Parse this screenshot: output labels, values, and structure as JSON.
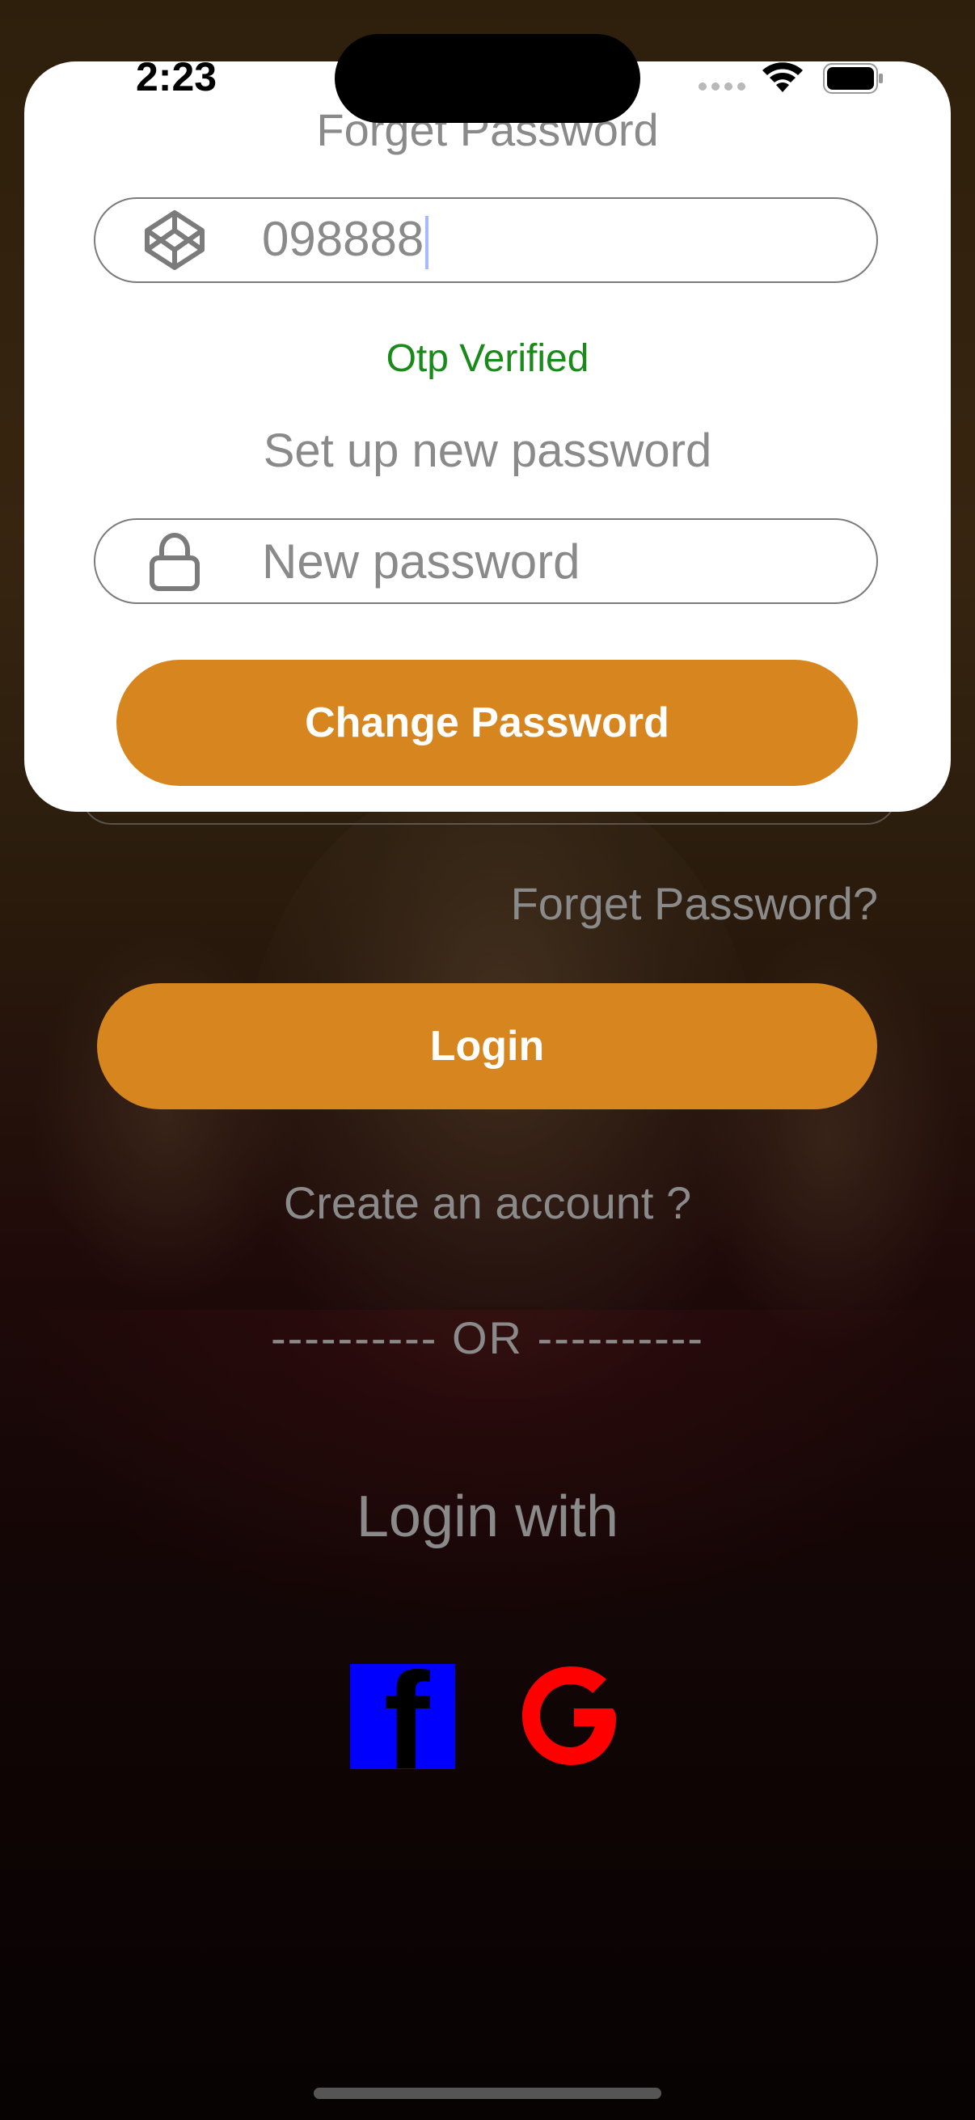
{
  "status_bar": {
    "time": "2:23"
  },
  "modal": {
    "title": "Forget Password",
    "otp_field": {
      "value": "098888",
      "icon": "codepen-cube-icon"
    },
    "otp_status": "Otp Verified",
    "setup_label": "Set up new password",
    "password_field": {
      "placeholder": "New password",
      "icon": "lock-icon"
    },
    "change_button": "Change Password"
  },
  "login": {
    "forget_link": "Forget Password?",
    "login_button": "Login",
    "create_account": "Create an account ?",
    "divider": "---------- OR ----------",
    "login_with": "Login with",
    "social": [
      {
        "name": "facebook",
        "icon": "facebook-icon",
        "color": "#0000ff"
      },
      {
        "name": "google",
        "icon": "google-icon",
        "color": "#ff0000"
      }
    ]
  },
  "colors": {
    "accent": "#d7861f",
    "success": "#1a8a1a"
  }
}
